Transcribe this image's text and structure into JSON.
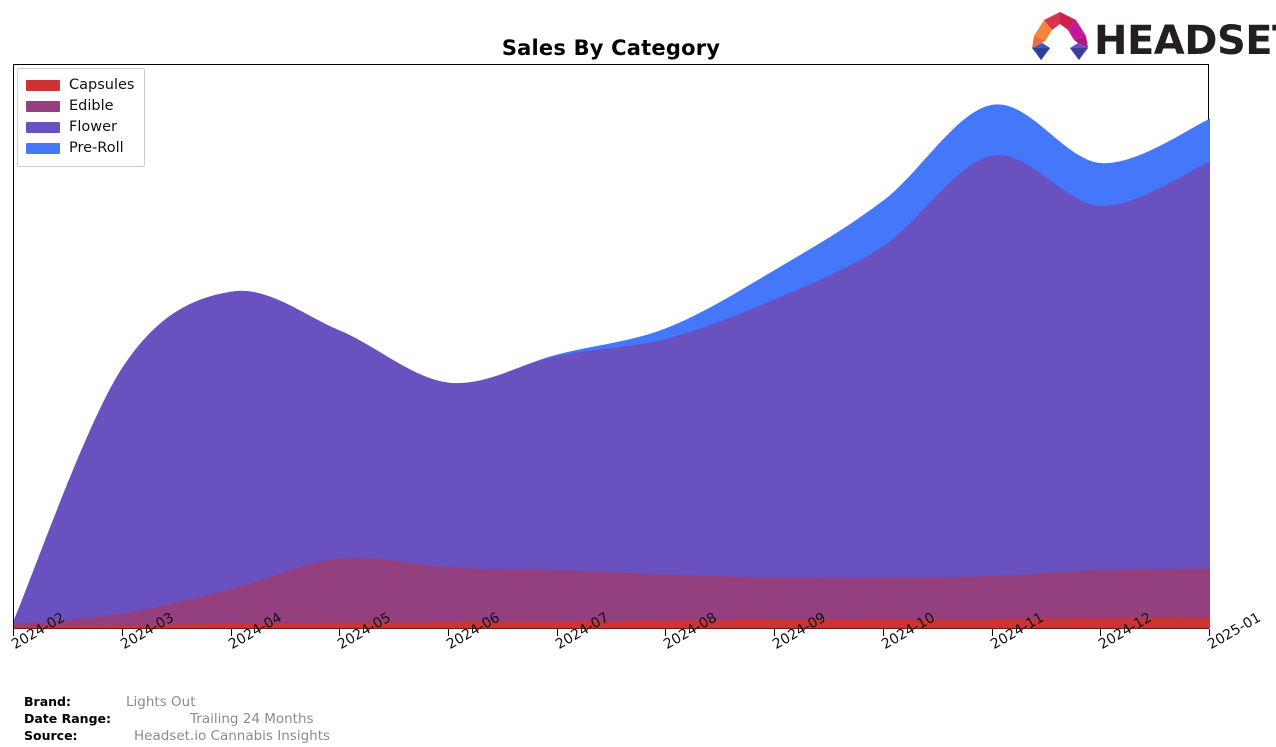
{
  "header": {
    "title": "Sales By Category",
    "logo_text": "HEADSET",
    "logo_icon": "headset-arch-logo"
  },
  "legend": {
    "position": "top-left",
    "items": [
      {
        "label": "Capsules",
        "color": "#cc3333"
      },
      {
        "label": "Edible",
        "color": "#94407f"
      },
      {
        "label": "Flower",
        "color": "#6951c0"
      },
      {
        "label": "Pre-Roll",
        "color": "#4477fa"
      }
    ]
  },
  "footer": {
    "rows": [
      {
        "key": "Brand:",
        "value": "Lights Out"
      },
      {
        "key": "Date Range:",
        "value": "Trailing 24 Months"
      },
      {
        "key": "Source:",
        "value": "Headset.io Cannabis Insights"
      }
    ]
  },
  "chart_data": {
    "type": "area",
    "stacked": true,
    "title": "Sales By Category",
    "xlabel": "",
    "ylabel": "",
    "grid": false,
    "legend_position": "top-left",
    "axis_ticks_visible": "x-only",
    "categories": [
      "2024-02",
      "2024-03",
      "2024-04",
      "2024-05",
      "2024-06",
      "2024-07",
      "2024-08",
      "2024-09",
      "2024-10",
      "2024-11",
      "2024-12",
      "2025-01"
    ],
    "tick_labels": [
      "2024-02",
      "2024-03",
      "2024-04",
      "2024-05",
      "2024-06",
      "2024-07",
      "2024-08",
      "2024-09",
      "2024-10",
      "2024-11",
      "2024-12",
      "2025-01"
    ],
    "ylim": [
      0,
      100
    ],
    "units": "relative sales (unlabeled axis)",
    "series": [
      {
        "name": "Capsules",
        "color": "#cc3333",
        "values": [
          0.3,
          0.6,
          0.9,
          1.1,
          1.2,
          1.3,
          1.5,
          1.6,
          1.7,
          1.8,
          1.9,
          2.0
        ]
      },
      {
        "name": "Edible",
        "color": "#94407f",
        "values": [
          0.6,
          2.2,
          6.5,
          12.0,
          10.2,
          9.6,
          8.6,
          7.9,
          7.8,
          8.0,
          9.0,
          9.2
        ]
      },
      {
        "name": "Flower",
        "color": "#6951c0",
        "values": [
          0.7,
          46.0,
          55.5,
          42.5,
          34.5,
          40.0,
          44.0,
          52.0,
          62.0,
          78.5,
          68.0,
          76.0
        ]
      },
      {
        "name": "Pre-Roll",
        "color": "#4477fa",
        "values": [
          0.0,
          0.0,
          0.0,
          0.0,
          0.0,
          0.3,
          2.0,
          5.5,
          8.5,
          9.5,
          8.0,
          8.0
        ]
      }
    ],
    "totals": [
      1.6,
      48.8,
      62.9,
      55.6,
      45.9,
      51.2,
      56.1,
      67.0,
      80.0,
      97.8,
      86.9,
      95.2
    ],
    "notes": "Smoothed stacked area chart; y-axis has no tick labels; peak total at 2024-11."
  }
}
